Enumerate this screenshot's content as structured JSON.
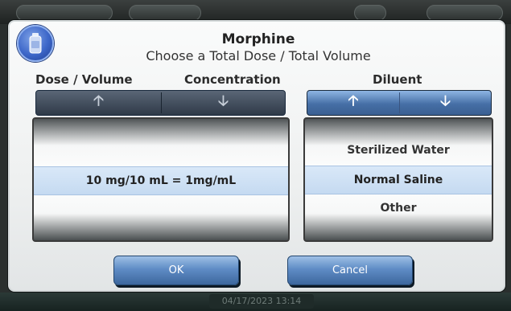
{
  "dialog": {
    "title": "Morphine",
    "subtitle": "Choose a Total Dose / Total Volume",
    "icon": "medication-bottle-icon",
    "ok_label": "OK",
    "cancel_label": "Cancel"
  },
  "columns": {
    "dose_volume_label": "Dose / Volume",
    "concentration_label": "Concentration",
    "diluent_label": "Diluent"
  },
  "dose_picker": {
    "selected": "10 mg/10 mL = 1mg/mL",
    "up_icon": "up-arrow-icon",
    "down_icon": "down-arrow-icon"
  },
  "diluent_picker": {
    "items": [
      "Sterilized Water",
      "Normal Saline",
      "Other"
    ],
    "selected_index": 1,
    "up_icon": "up-arrow-icon",
    "down_icon": "down-arrow-icon"
  },
  "status": {
    "timestamp": "04/17/2023 13:14"
  },
  "colors": {
    "accent_blue": "#5f8cc5",
    "selection_blue": "#c5daf1"
  }
}
